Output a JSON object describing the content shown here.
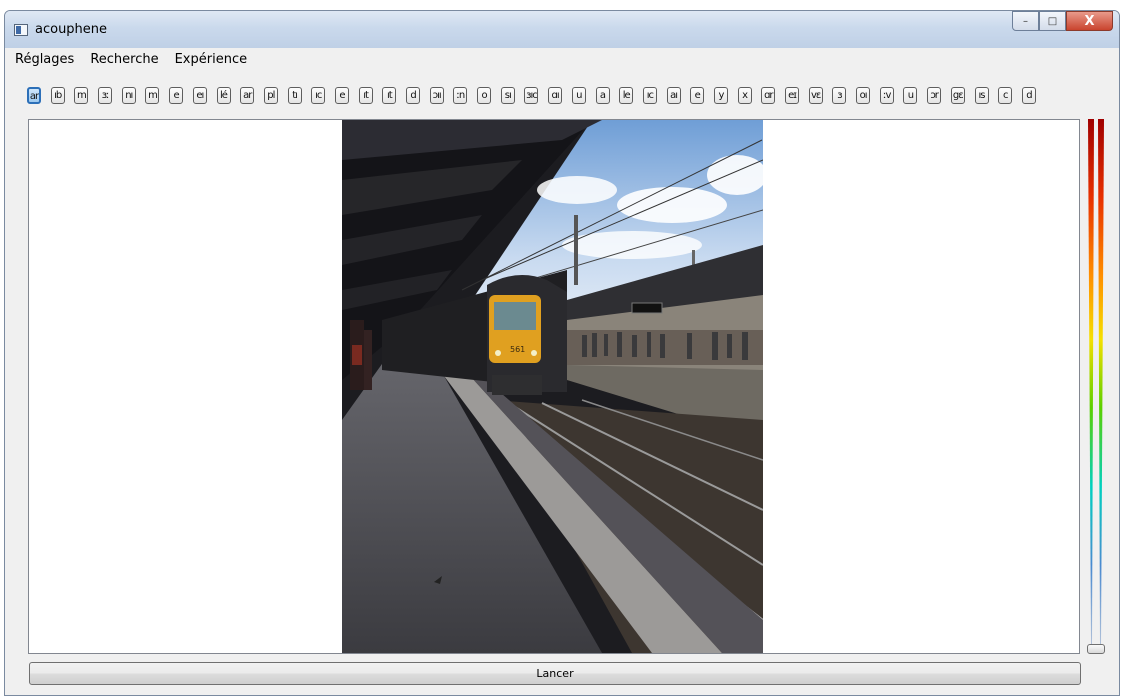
{
  "window": {
    "title": "acouphene",
    "controls": [
      "minimize-icon",
      "maximize-icon",
      "close-icon"
    ]
  },
  "menu": [
    "Réglages",
    "Recherche",
    "Expérience"
  ],
  "toolbar": {
    "active_index": 0,
    "buttons": [
      "ar",
      "ıb",
      "m",
      "ɜː",
      "nı",
      "m",
      "e",
      "eı",
      "lé",
      "ar",
      "pl",
      "tı",
      "ıc",
      "e",
      "ıt",
      "ıt",
      "d",
      "ɔıı",
      "ːn",
      "o",
      "sı",
      "ɜıc",
      "ɑı",
      "u",
      "a",
      "le",
      "ıc",
      "aı",
      "e",
      "y",
      "x",
      "ɑr",
      "eɪ",
      "vɛ",
      "ɜ",
      "oı",
      "ːv",
      "u",
      "ɔr",
      "gɛ",
      "ıs",
      "c",
      "d"
    ]
  },
  "image": {
    "semantic": "train-station-platform-photo",
    "display_number": "561"
  },
  "slider": {
    "semantic": "vertical-intensity-slider",
    "value": 0,
    "gradient_colors": [
      "#a00000",
      "#e83000",
      "#ff9000",
      "#f5e000",
      "#5cd000",
      "#00d0c0",
      "#4a8ad0",
      "#b0c0d8"
    ]
  },
  "actions": {
    "launch_label": "Lancer"
  }
}
